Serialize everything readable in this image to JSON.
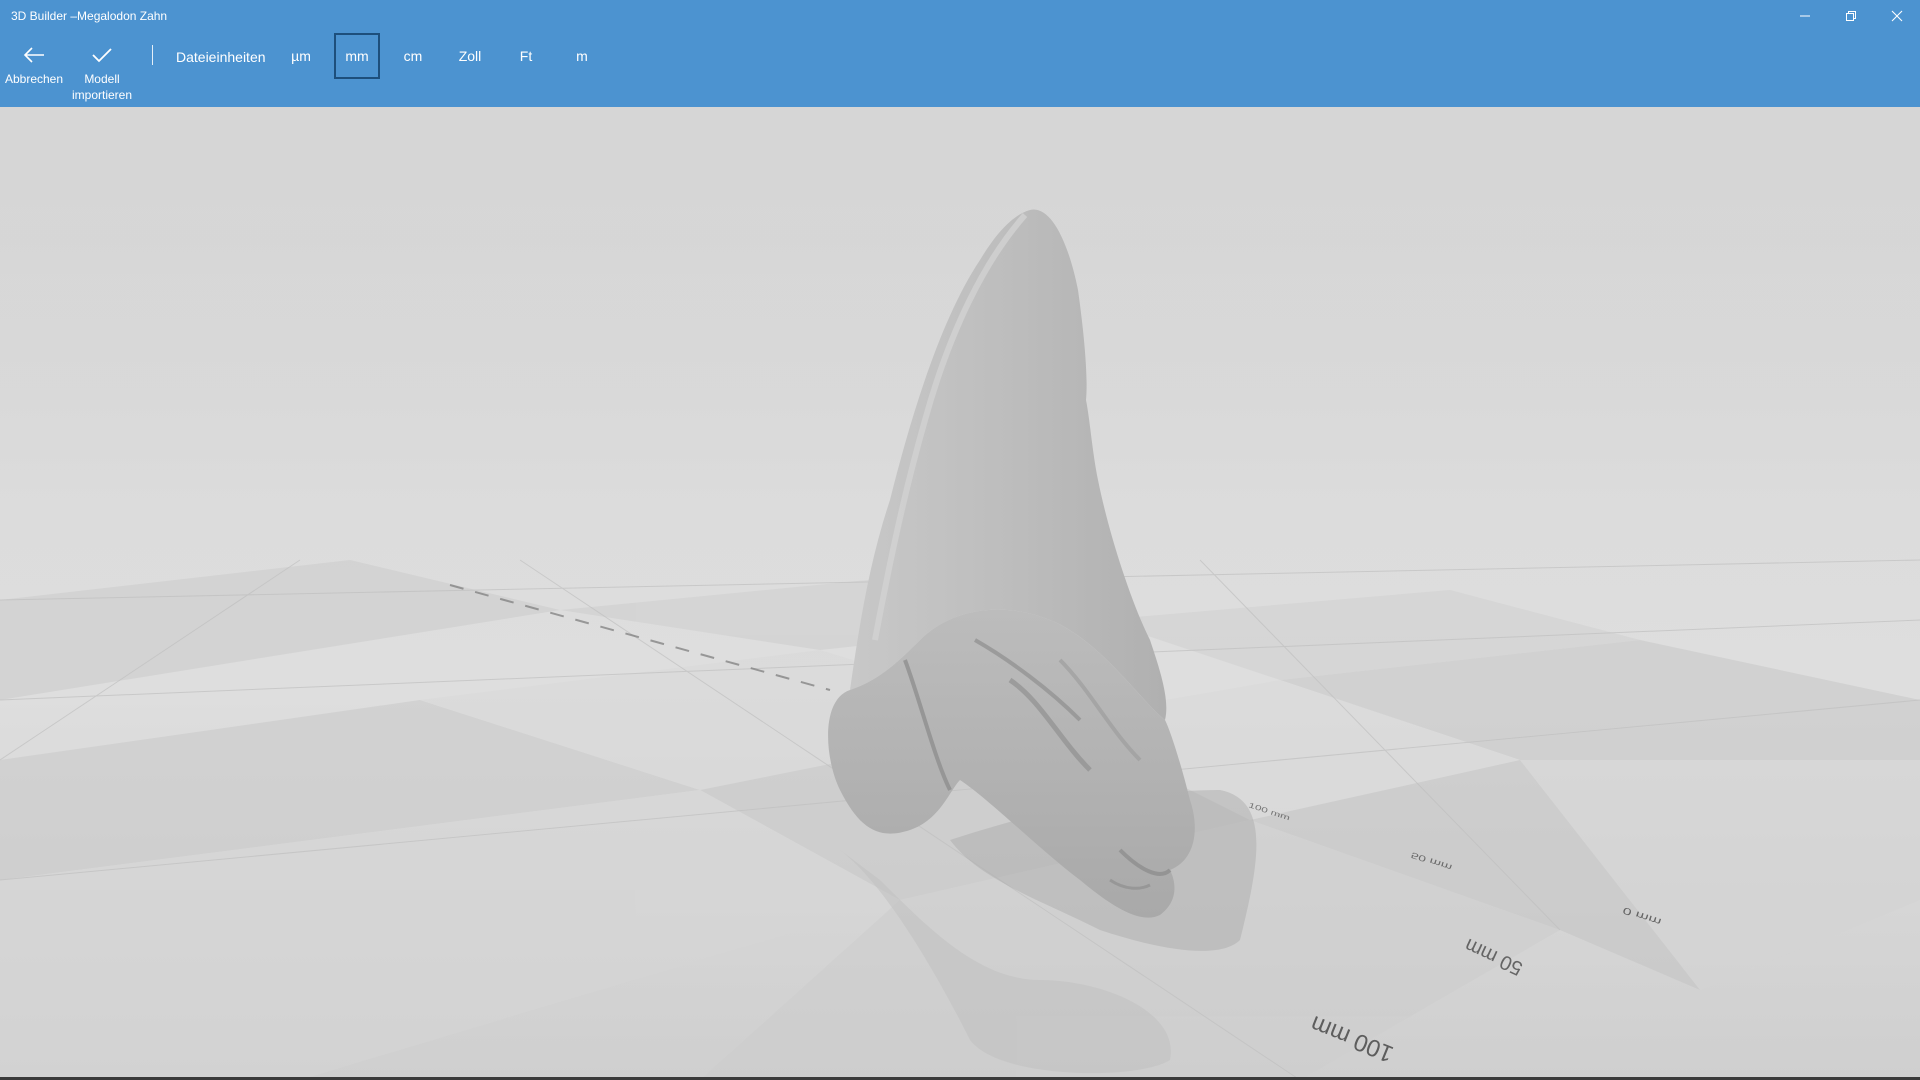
{
  "window": {
    "title": "3D Builder –Megalodon Zahn"
  },
  "commands": {
    "cancel_label": "Abbrechen",
    "import_label": "Modell importieren",
    "units_label": "Dateieinheiten"
  },
  "units": {
    "options": [
      "µm",
      "mm",
      "cm",
      "Zoll",
      "Ft",
      "m"
    ],
    "selected": "mm"
  },
  "scene": {
    "object": "Megalodon tooth 3D model",
    "ruler_labels": [
      "100 mm",
      "50 mm",
      "0 mm",
      "50 mm",
      "100 mm"
    ]
  },
  "colors": {
    "accent": "#4c93d0",
    "selected_border": "#1d4f7c",
    "viewport_background": "#d3d3d3",
    "model": "#bdbdbd"
  },
  "icons": {
    "back": "arrow-left-icon",
    "confirm": "checkmark-icon",
    "minimize": "minimize-icon",
    "restore": "restore-icon",
    "close": "close-icon"
  }
}
